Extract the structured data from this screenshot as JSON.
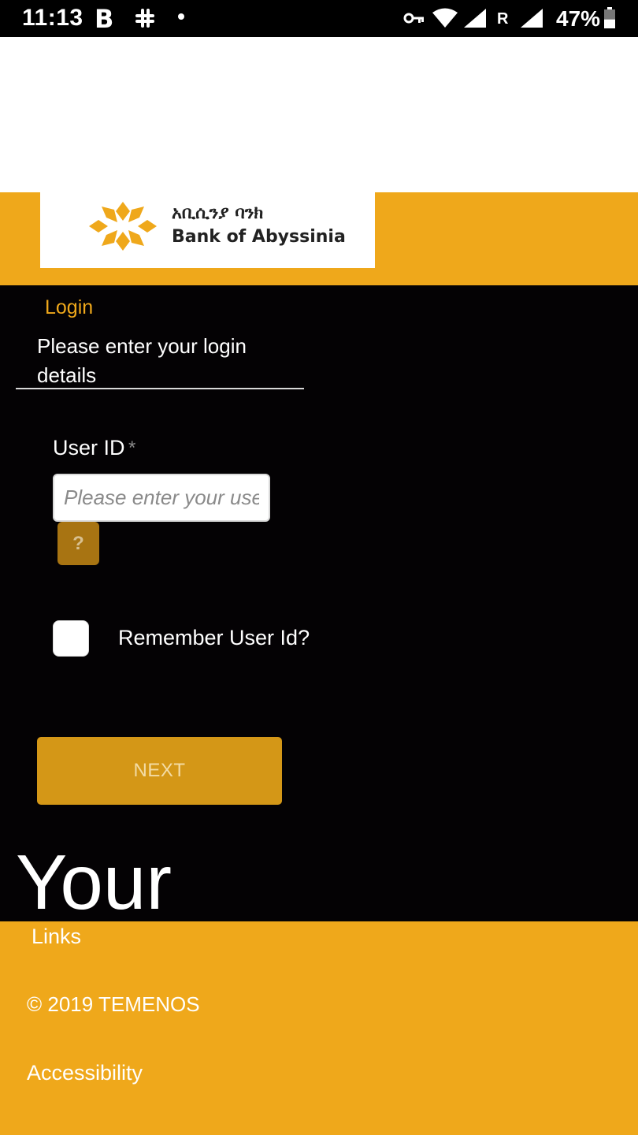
{
  "status_bar": {
    "time": "11:13",
    "b_icon_glyph": "B",
    "roaming_label": "R",
    "battery_text": "47%",
    "battery_level": 0.47,
    "icons": [
      "b-app-icon",
      "slack-icon",
      "dot-icon",
      "vpn-key-icon",
      "wifi-icon",
      "signal-icon",
      "signal-icon",
      "battery-icon"
    ]
  },
  "logo": {
    "amharic": "አቢሲንያ ባንክ",
    "english": "Bank of Abyssinia",
    "colors": {
      "mark": "#efa81b",
      "text": "#222222"
    }
  },
  "login": {
    "title": "Login",
    "subtitle": "Please enter your login details",
    "userid_label": "User ID",
    "required_marker": "*",
    "userid_placeholder": "Please enter your user ID",
    "userid_value": "",
    "help_label": "?",
    "remember_label": "Remember User Id?",
    "remember_checked": false,
    "next_label": "NEXT"
  },
  "big_heading": "Your",
  "footer": {
    "links_heading": "Links",
    "copyright": "© 2019 TEMENOS",
    "accessibility": "Accessibility"
  },
  "colors": {
    "brand_orange": "#efa81b",
    "button_orange": "#d49717",
    "help_button": "#a87412",
    "background": "#040204"
  }
}
